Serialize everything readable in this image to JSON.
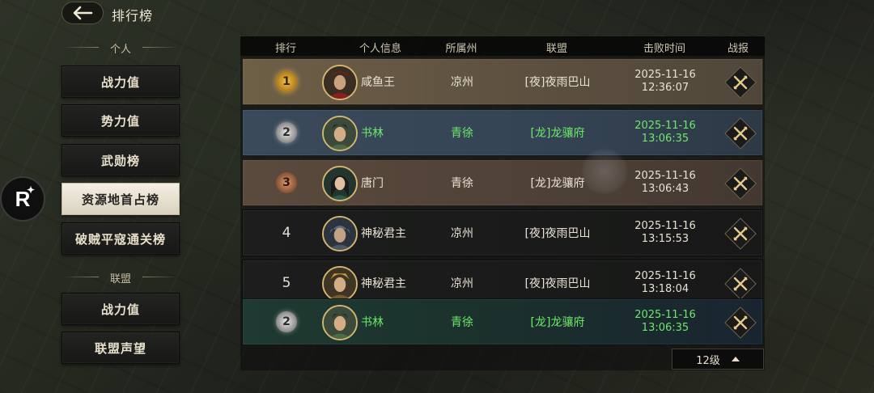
{
  "header": {
    "title": "排行榜",
    "back_icon": "back-arrow-icon"
  },
  "sidebar": {
    "personal_label": "个人",
    "personal_items": [
      {
        "label": "战力值"
      },
      {
        "label": "势力值"
      },
      {
        "label": "武勋榜"
      },
      {
        "label": "资源地首占榜",
        "active": true
      },
      {
        "label": "破贼平寇通关榜"
      }
    ],
    "alliance_label": "联盟",
    "alliance_items": [
      {
        "label": "战力值"
      },
      {
        "label": "联盟声望"
      }
    ]
  },
  "overlay_badge": {
    "text": "R",
    "star": "✦"
  },
  "table": {
    "headers": {
      "rank": "排行",
      "info": "个人信息",
      "state": "所属州",
      "alliance": "联盟",
      "time": "击败时间",
      "report": "战报"
    },
    "rows": [
      {
        "rank": "1",
        "name": "咸鱼王",
        "state": "凉州",
        "alliance": "[夜]夜雨巴山",
        "date": "2025-11-16",
        "time": "12:36:07",
        "style": "gold"
      },
      {
        "rank": "2",
        "name": "书林",
        "state": "青徐",
        "alliance": "[龙]龙骧府",
        "date": "2025-11-16",
        "time": "13:06:35",
        "style": "silver"
      },
      {
        "rank": "3",
        "name": "唐门",
        "state": "青徐",
        "alliance": "[龙]龙骧府",
        "date": "2025-11-16",
        "time": "13:06:43",
        "style": "bronze"
      },
      {
        "rank": "4",
        "name": "神秘君主",
        "state": "凉州",
        "alliance": "[夜]夜雨巴山",
        "date": "2025-11-16",
        "time": "13:15:53",
        "style": "plain"
      },
      {
        "rank": "5",
        "name": "神秘君主",
        "state": "凉州",
        "alliance": "[夜]夜雨巴山",
        "date": "2025-11-16",
        "time": "13:18:04",
        "style": "plain"
      }
    ],
    "self_row": {
      "rank": "2",
      "name": "书林",
      "state": "青徐",
      "alliance": "[龙]龙骧府",
      "date": "2025-11-16",
      "time": "13:06:35"
    },
    "report_icon": "crossed-swords-icon"
  },
  "level_selector": {
    "label": "12级",
    "icon": "triangle-up-icon"
  },
  "colors": {
    "highlight_green": "#6ee86a",
    "gold_border": "#d4b66f"
  }
}
